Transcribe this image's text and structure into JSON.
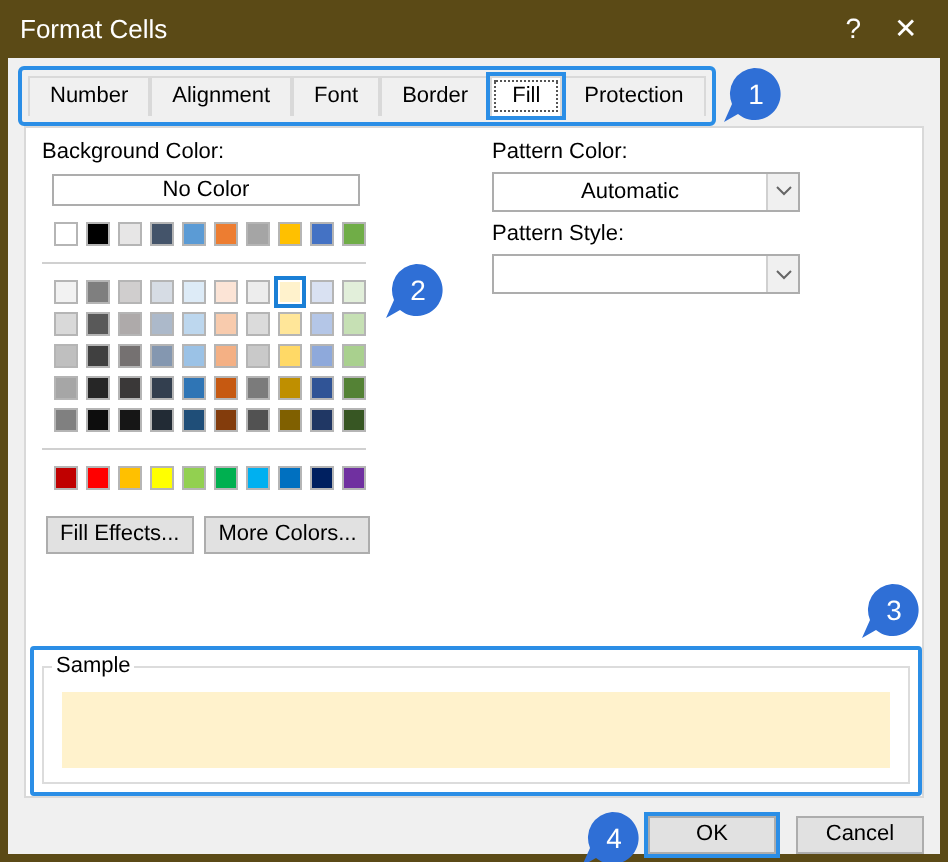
{
  "window": {
    "title": "Format Cells",
    "help": "?",
    "close": "✕"
  },
  "tab_strip": {
    "highlighted": true,
    "tabs": [
      {
        "label": "Number",
        "selected": false
      },
      {
        "label": "Alignment",
        "selected": false
      },
      {
        "label": "Font",
        "selected": false
      },
      {
        "label": "Border",
        "selected": false
      },
      {
        "label": "Fill",
        "selected": true
      },
      {
        "label": "Protection",
        "selected": false
      }
    ]
  },
  "background_color": {
    "label": "Background Color:",
    "no_color": "No Color",
    "theme_colors": [
      {
        "color": "#ffffff",
        "selected": false
      },
      {
        "color": "#000000",
        "selected": false
      },
      {
        "color": "#e7e6e6",
        "selected": false
      },
      {
        "color": "#44546a",
        "selected": false
      },
      {
        "color": "#5b9bd5",
        "selected": false
      },
      {
        "color": "#ed7d31",
        "selected": false
      },
      {
        "color": "#a5a5a5",
        "selected": false
      },
      {
        "color": "#ffc000",
        "selected": false
      },
      {
        "color": "#4472c4",
        "selected": false
      },
      {
        "color": "#70ad47",
        "selected": false
      }
    ],
    "shades": [
      [
        {
          "color": "#f2f2f2",
          "selected": false
        },
        {
          "color": "#7f7f7f",
          "selected": false
        },
        {
          "color": "#d0cece",
          "selected": false
        },
        {
          "color": "#d6dce4",
          "selected": false
        },
        {
          "color": "#ddebf7",
          "selected": false
        },
        {
          "color": "#fce4d6",
          "selected": false
        },
        {
          "color": "#ededed",
          "selected": false
        },
        {
          "color": "#fff2cc",
          "selected": true
        },
        {
          "color": "#d9e1f2",
          "selected": false
        },
        {
          "color": "#e2efda",
          "selected": false
        }
      ],
      [
        {
          "color": "#d9d9d9",
          "selected": false
        },
        {
          "color": "#595959",
          "selected": false
        },
        {
          "color": "#aeaaaa",
          "selected": false
        },
        {
          "color": "#acb9ca",
          "selected": false
        },
        {
          "color": "#bdd7ee",
          "selected": false
        },
        {
          "color": "#f8cbad",
          "selected": false
        },
        {
          "color": "#dbdbdb",
          "selected": false
        },
        {
          "color": "#ffe699",
          "selected": false
        },
        {
          "color": "#b4c6e7",
          "selected": false
        },
        {
          "color": "#c6e0b4",
          "selected": false
        }
      ],
      [
        {
          "color": "#bfbfbf",
          "selected": false
        },
        {
          "color": "#404040",
          "selected": false
        },
        {
          "color": "#757171",
          "selected": false
        },
        {
          "color": "#8497b0",
          "selected": false
        },
        {
          "color": "#9bc2e6",
          "selected": false
        },
        {
          "color": "#f4b084",
          "selected": false
        },
        {
          "color": "#c9c9c9",
          "selected": false
        },
        {
          "color": "#ffd966",
          "selected": false
        },
        {
          "color": "#8ea9db",
          "selected": false
        },
        {
          "color": "#a9d08e",
          "selected": false
        }
      ],
      [
        {
          "color": "#a6a6a6",
          "selected": false
        },
        {
          "color": "#262626",
          "selected": false
        },
        {
          "color": "#3a3838",
          "selected": false
        },
        {
          "color": "#333f4f",
          "selected": false
        },
        {
          "color": "#2f75b5",
          "selected": false
        },
        {
          "color": "#c65911",
          "selected": false
        },
        {
          "color": "#7b7b7b",
          "selected": false
        },
        {
          "color": "#bf8f00",
          "selected": false
        },
        {
          "color": "#305496",
          "selected": false
        },
        {
          "color": "#548235",
          "selected": false
        }
      ],
      [
        {
          "color": "#808080",
          "selected": false
        },
        {
          "color": "#0d0d0d",
          "selected": false
        },
        {
          "color": "#161616",
          "selected": false
        },
        {
          "color": "#222b35",
          "selected": false
        },
        {
          "color": "#1f4e78",
          "selected": false
        },
        {
          "color": "#833c0c",
          "selected": false
        },
        {
          "color": "#525252",
          "selected": false
        },
        {
          "color": "#806000",
          "selected": false
        },
        {
          "color": "#203764",
          "selected": false
        },
        {
          "color": "#375623",
          "selected": false
        }
      ]
    ],
    "standard_colors": [
      {
        "color": "#c00000",
        "selected": false
      },
      {
        "color": "#ff0000",
        "selected": false
      },
      {
        "color": "#ffc000",
        "selected": false
      },
      {
        "color": "#ffff00",
        "selected": false
      },
      {
        "color": "#92d050",
        "selected": false
      },
      {
        "color": "#00b050",
        "selected": false
      },
      {
        "color": "#00b0f0",
        "selected": false
      },
      {
        "color": "#0070c0",
        "selected": false
      },
      {
        "color": "#002060",
        "selected": false
      },
      {
        "color": "#7030a0",
        "selected": false
      }
    ],
    "buttons": [
      "Fill Effects...",
      "More Colors..."
    ]
  },
  "pattern_color": {
    "label": "Pattern Color:",
    "value": "Automatic"
  },
  "pattern_style": {
    "label": "Pattern Style:"
  },
  "sample": {
    "label": "Sample",
    "highlighted": true
  },
  "buttons": [
    {
      "label": "OK",
      "highlighted": true
    },
    {
      "label": "Cancel",
      "highlighted": false
    }
  ],
  "callouts": [
    {
      "number": "1"
    },
    {
      "number": "2"
    },
    {
      "number": "3"
    },
    {
      "number": "4"
    }
  ]
}
